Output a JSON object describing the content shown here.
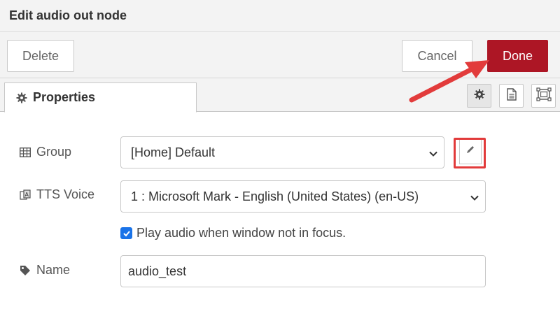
{
  "dialog": {
    "title": "Edit audio out node"
  },
  "toolbar": {
    "delete_label": "Delete",
    "cancel_label": "Cancel",
    "done_label": "Done"
  },
  "tabs": {
    "properties_label": "Properties"
  },
  "form": {
    "group_label": "Group",
    "group_value": "[Home] Default",
    "tts_label": "TTS Voice",
    "tts_value": "1 : Microsoft Mark - English (United States) (en-US)",
    "play_audio_label": "Play audio when window not in focus.",
    "play_audio_checked": true,
    "name_label": "Name",
    "name_value": "audio_test"
  },
  "colors": {
    "done_button": "#ad1625",
    "annotation": "#e23b3b",
    "checkbox": "#1a73e8"
  },
  "icons": [
    "gear-icon",
    "table-icon",
    "tts-icon",
    "tag-icon",
    "pencil-icon",
    "chevron-down-icon",
    "file-text-icon",
    "frame-icon",
    "check-icon"
  ]
}
